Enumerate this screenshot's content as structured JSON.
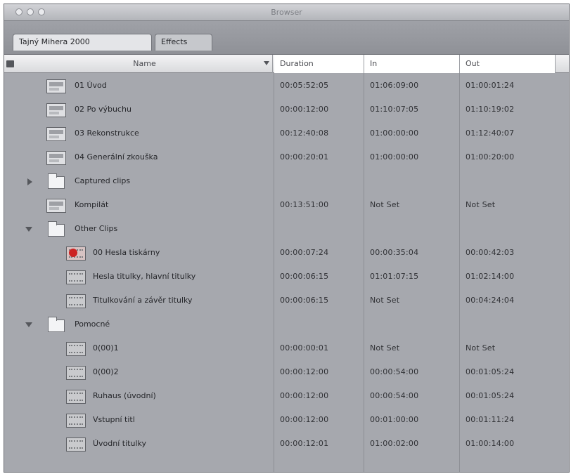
{
  "window": {
    "title": "Browser"
  },
  "tabs": [
    {
      "label": "Tajný Mihera 2000"
    },
    {
      "label": "Effects"
    }
  ],
  "columns": {
    "name": "Name",
    "duration": "Duration",
    "in": "In",
    "out": "Out"
  },
  "rows": [
    {
      "name": "01 Úvod",
      "duration": "00:05:52:05",
      "in": "01:06:09:00",
      "out": "01:00:01:24"
    },
    {
      "name": "02 Po výbuchu",
      "duration": "00:00:12:00",
      "in": "01:10:07:05",
      "out": "01:10:19:02"
    },
    {
      "name": "03 Rekonstrukce",
      "duration": "00:12:40:08",
      "in": "01:00:00:00",
      "out": "01:12:40:07"
    },
    {
      "name": "04 Generální zkouška",
      "duration": "00:00:20:01",
      "in": "01:00:00:00",
      "out": "01:00:20:00"
    },
    {
      "name": "Captured clips",
      "duration": "",
      "in": "",
      "out": ""
    },
    {
      "name": "Kompilát",
      "duration": "00:13:51:00",
      "in": "Not Set",
      "out": "Not Set"
    },
    {
      "name": "Other Clips",
      "duration": "",
      "in": "",
      "out": ""
    },
    {
      "name": "00 Hesla tiskárny",
      "duration": "00:00:07:24",
      "in": "00:00:35:04",
      "out": "00:00:42:03"
    },
    {
      "name": "Hesla titulky, hlavní titulky",
      "duration": "00:00:06:15",
      "in": "01:01:07:15",
      "out": "01:02:14:00"
    },
    {
      "name": "Titulkování a závěr titulky",
      "duration": "00:00:06:15",
      "in": "Not Set",
      "out": "00:04:24:04"
    },
    {
      "name": "Pomocné",
      "duration": "",
      "in": "",
      "out": ""
    },
    {
      "name": "0(00)1",
      "duration": "00:00:00:01",
      "in": "Not Set",
      "out": "Not Set"
    },
    {
      "name": "0(00)2",
      "duration": "00:00:12:00",
      "in": "00:00:54:00",
      "out": "00:01:05:24"
    },
    {
      "name": "Ruhaus (úvodní)",
      "duration": "00:00:12:00",
      "in": "00:00:54:00",
      "out": "00:01:05:24"
    },
    {
      "name": "Vstupní titl",
      "duration": "00:00:12:00",
      "in": "00:01:00:00",
      "out": "00:01:11:24"
    },
    {
      "name": "Úvodní titulky",
      "duration": "00:00:12:01",
      "in": "01:00:02:00",
      "out": "01:00:14:00"
    }
  ]
}
